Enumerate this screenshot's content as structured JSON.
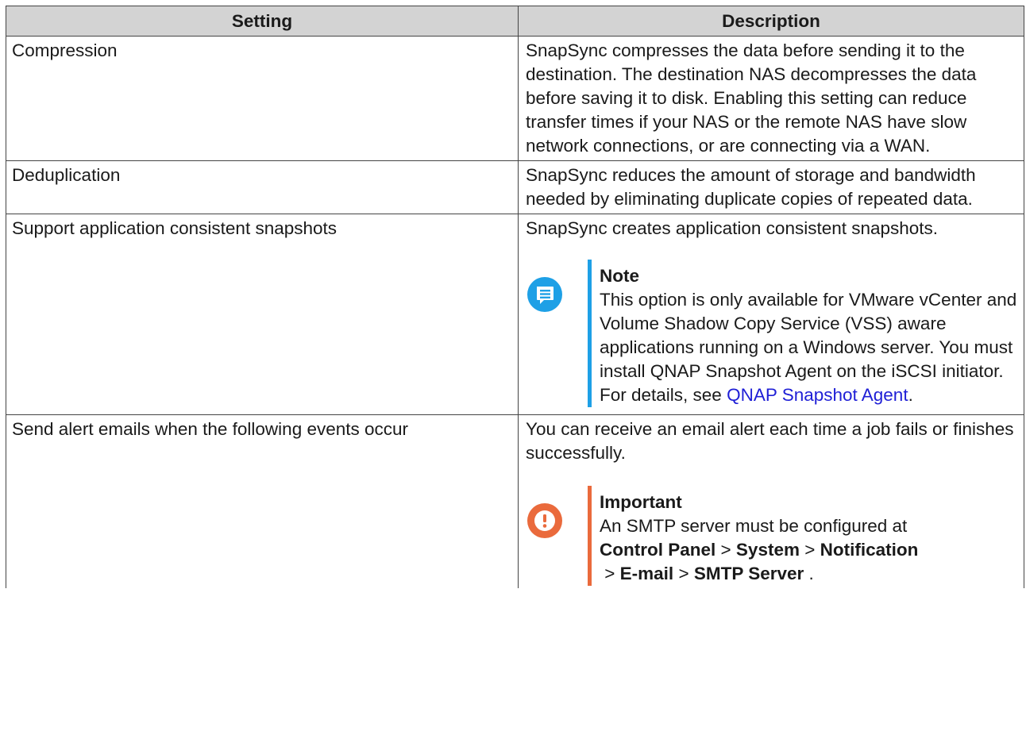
{
  "table": {
    "headers": [
      "Setting",
      "Description"
    ],
    "rows": [
      {
        "setting": "Compression",
        "description": "SnapSync compresses the data before sending it to the destination. The destination NAS decompresses the data before saving it to disk. Enabling this setting can reduce transfer times if your NAS or the remote NAS have slow network connections, or are connecting via a WAN."
      },
      {
        "setting": "Deduplication",
        "description": "SnapSync reduces the amount of storage and bandwidth needed by eliminating duplicate copies of repeated data."
      },
      {
        "setting": "Support application consistent snapshots",
        "description": "SnapSync creates application consistent snapshots.",
        "note": {
          "title": "Note",
          "text": "This option is only available for VMware vCenter and Volume Shadow Copy Service (VSS) aware applications running on a Windows server. You must install QNAP Snapshot Agent on the iSCSI initiator. For details, see ",
          "link": "QNAP Snapshot Agent",
          "after": ".",
          "icon": "note-icon",
          "color": "#1ea0e6"
        }
      },
      {
        "setting": "Send alert emails when the following events occur",
        "description": "You can receive an email alert each time a job fails or finishes successfully.",
        "important": {
          "title": "Important",
          "intro": "An SMTP server must be configured at ",
          "path": [
            "Control Panel",
            "System",
            "Notification",
            "E-mail",
            "SMTP Server"
          ],
          "separator": " > ",
          "after": " .",
          "icon": "exclamation-icon",
          "color": "#ea6a3c"
        }
      }
    ]
  },
  "colors": {
    "header_bg": "#d3d3d3",
    "border": "#444444",
    "link": "#1f1fd6"
  }
}
